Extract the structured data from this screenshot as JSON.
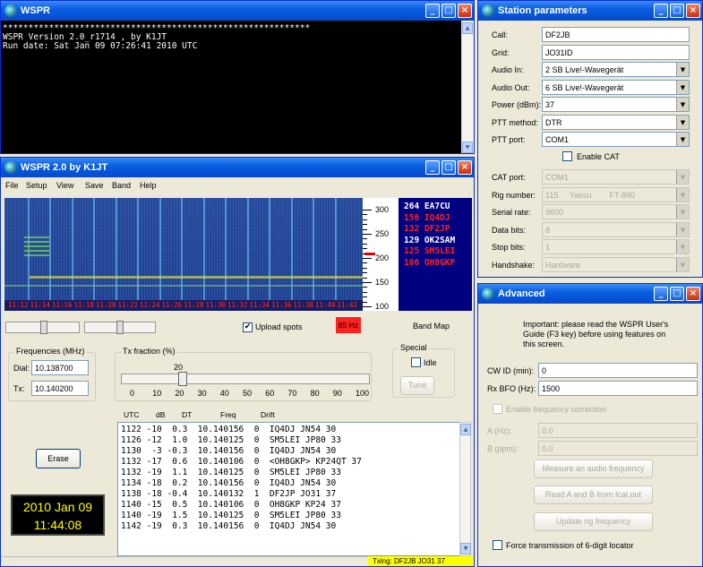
{
  "console": {
    "title": "WSPR",
    "lines": [
      "************************************************************",
      "WSPR Version 2.0_r1714 , by K1JT",
      "Run date:   Sat Jan 09 07:26:41 2010 UTC"
    ]
  },
  "main": {
    "title": "WSPR 2.0     by K1JT",
    "menu": [
      "File",
      "Setup",
      "View",
      "Save",
      "Band",
      "Help"
    ],
    "wf_times": [
      "11:12",
      "11:14",
      "11:16",
      "11:18",
      "11:20",
      "11:22",
      "11:24",
      "11:26",
      "11:28",
      "11:30",
      "11:32",
      "11:34",
      "11:36",
      "11:38",
      "11:40",
      "11:42"
    ],
    "scale_ticks": [
      "300",
      "250",
      "200",
      "150",
      "100"
    ],
    "calls": [
      {
        "num": "264",
        "call": "EA7CU",
        "color": "#ffffff"
      },
      {
        "num": "156",
        "call": "IQ4DJ",
        "color": "#ff2020"
      },
      {
        "num": "132",
        "call": "DF2JP",
        "color": "#ff2020"
      },
      {
        "num": "129",
        "call": "OK2SAM",
        "color": "#ffffff"
      },
      {
        "num": "125",
        "call": "SM5LEI",
        "color": "#ff2020"
      },
      {
        "num": "106",
        "call": "OH8GKP",
        "color": "#ff2020"
      }
    ],
    "upload_label": "Upload spots",
    "hz_label": "85 Hz",
    "bandmap_label": "Band Map",
    "freq_group": "Frequencies (MHz)",
    "dial_label": "Dial:",
    "dial_value": "10.138700",
    "tx_label": "Tx:",
    "tx_value": "10.140200",
    "txfrac_group": "Tx fraction (%)",
    "txfrac_value": "20",
    "txfrac_level": 20,
    "txfrac_ticks": [
      "0",
      "10",
      "20",
      "30",
      "40",
      "50",
      "60",
      "70",
      "80",
      "90",
      "100"
    ],
    "special_group": "Special",
    "idle_label": "Idle",
    "tune_label": "Tune",
    "erase_label": "Erase",
    "headers": [
      "UTC",
      "dB",
      "DT",
      "Freq",
      "Drift"
    ],
    "spots": [
      "1122 -10  0.3  10.140156  0  IQ4DJ JN54 30",
      "1126 -12  1.0  10.140125  0  SM5LEI JP80 33",
      "1130  -3 -0.3  10.140156  0  IQ4DJ JN54 30",
      "1132 -17  0.6  10.140106  0  <OH8GKP> KP24QT 37",
      "1132 -19  1.1  10.140125  0  SM5LEI JP80 33",
      "1134 -18  0.2  10.140156  0  IQ4DJ JN54 30",
      "1138 -18 -0.4  10.140132  1  DF2JP JO31 37",
      "1140 -15  0.5  10.140106  0  OH8GKP KP24 37",
      "1140 -19  1.5  10.140125  0  SM5LEI JP80 33",
      "1142 -19  0.3  10.140156  0  IQ4DJ JN54 30"
    ],
    "date": "2010 Jan 09",
    "time": "11:44:08",
    "txing": "Txing: DF2JB JO31 37"
  },
  "station": {
    "title": "Station parameters",
    "rows": [
      {
        "label": "Call:",
        "value": "DF2JB",
        "dd": false,
        "dis": false
      },
      {
        "label": "Grid:",
        "value": "JO31ID",
        "dd": false,
        "dis": false
      },
      {
        "label": "Audio In:",
        "value": "2 SB Live!-Wavegerät",
        "dd": true,
        "dis": false
      },
      {
        "label": "Audio Out:",
        "value": "6 SB Live!-Wavegerät",
        "dd": true,
        "dis": false
      },
      {
        "label": "Power (dBm):",
        "value": "37",
        "dd": true,
        "dis": false
      },
      {
        "label": "PTT method:",
        "value": "DTR",
        "dd": true,
        "dis": false
      },
      {
        "label": "PTT port:",
        "value": "COM1",
        "dd": true,
        "dis": false
      }
    ],
    "enable_cat": "Enable CAT",
    "rows2": [
      {
        "label": "CAT port:",
        "value": "COM1",
        "dd": true
      },
      {
        "label": "Rig number:",
        "value": "115     Yaesu        FT-890",
        "dd": true
      },
      {
        "label": "Serial rate:",
        "value": "9600",
        "dd": true
      },
      {
        "label": "Data bits:",
        "value": "8",
        "dd": true
      },
      {
        "label": "Stop bits:",
        "value": "1",
        "dd": true
      },
      {
        "label": "Handshake:",
        "value": "Hardware",
        "dd": true
      }
    ]
  },
  "advanced": {
    "title": "Advanced",
    "note": "Important:   please read the WSPR User's Guide (F3 key) before using features on this screen.",
    "cwid_label": "CW ID (min):",
    "cwid_value": "0",
    "rxbfo_label": "Rx BFO (Hz):",
    "rxbfo_value": "1500",
    "enable_fc": "Enable frequency correction",
    "a_label": "A (Hz):",
    "a_value": "0.0",
    "b_label": "B (ppm):",
    "b_value": "0.0",
    "measure": "Measure an audio frequency",
    "read_ab": "Read A and B from fcal.out",
    "update_rig": "Update rig frequency",
    "force6": "Force transmission of 6-digit locator"
  }
}
